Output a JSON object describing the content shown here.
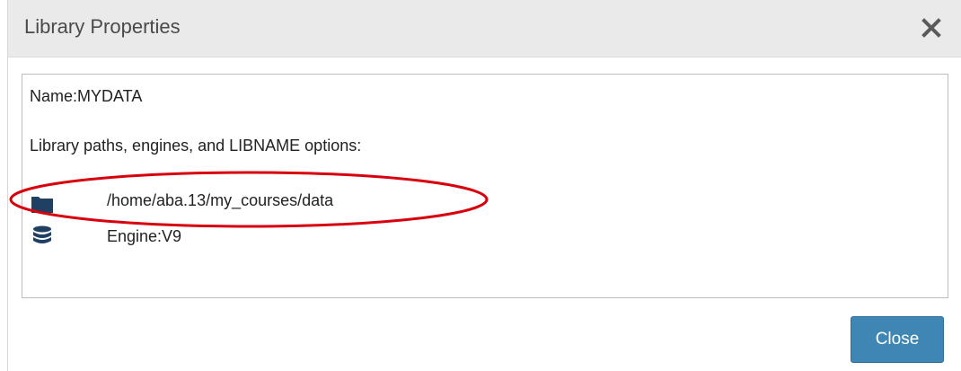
{
  "dialog": {
    "title": "Library Properties",
    "close_icon": "close-x-icon",
    "close_button_label": "Close"
  },
  "content": {
    "name_line": "Name:MYDATA",
    "paths_label": "Library paths, engines, and LIBNAME options:",
    "rows": [
      {
        "icon": "folder-icon",
        "text": "/home/aba.13/my_courses/data"
      },
      {
        "icon": "database-icon",
        "text": "Engine:V9"
      }
    ]
  },
  "colors": {
    "titlebar_bg": "#eaeaea",
    "button_bg": "#3f86b4",
    "folder_icon": "#1f3f63",
    "annotation_red": "#d8000c"
  }
}
